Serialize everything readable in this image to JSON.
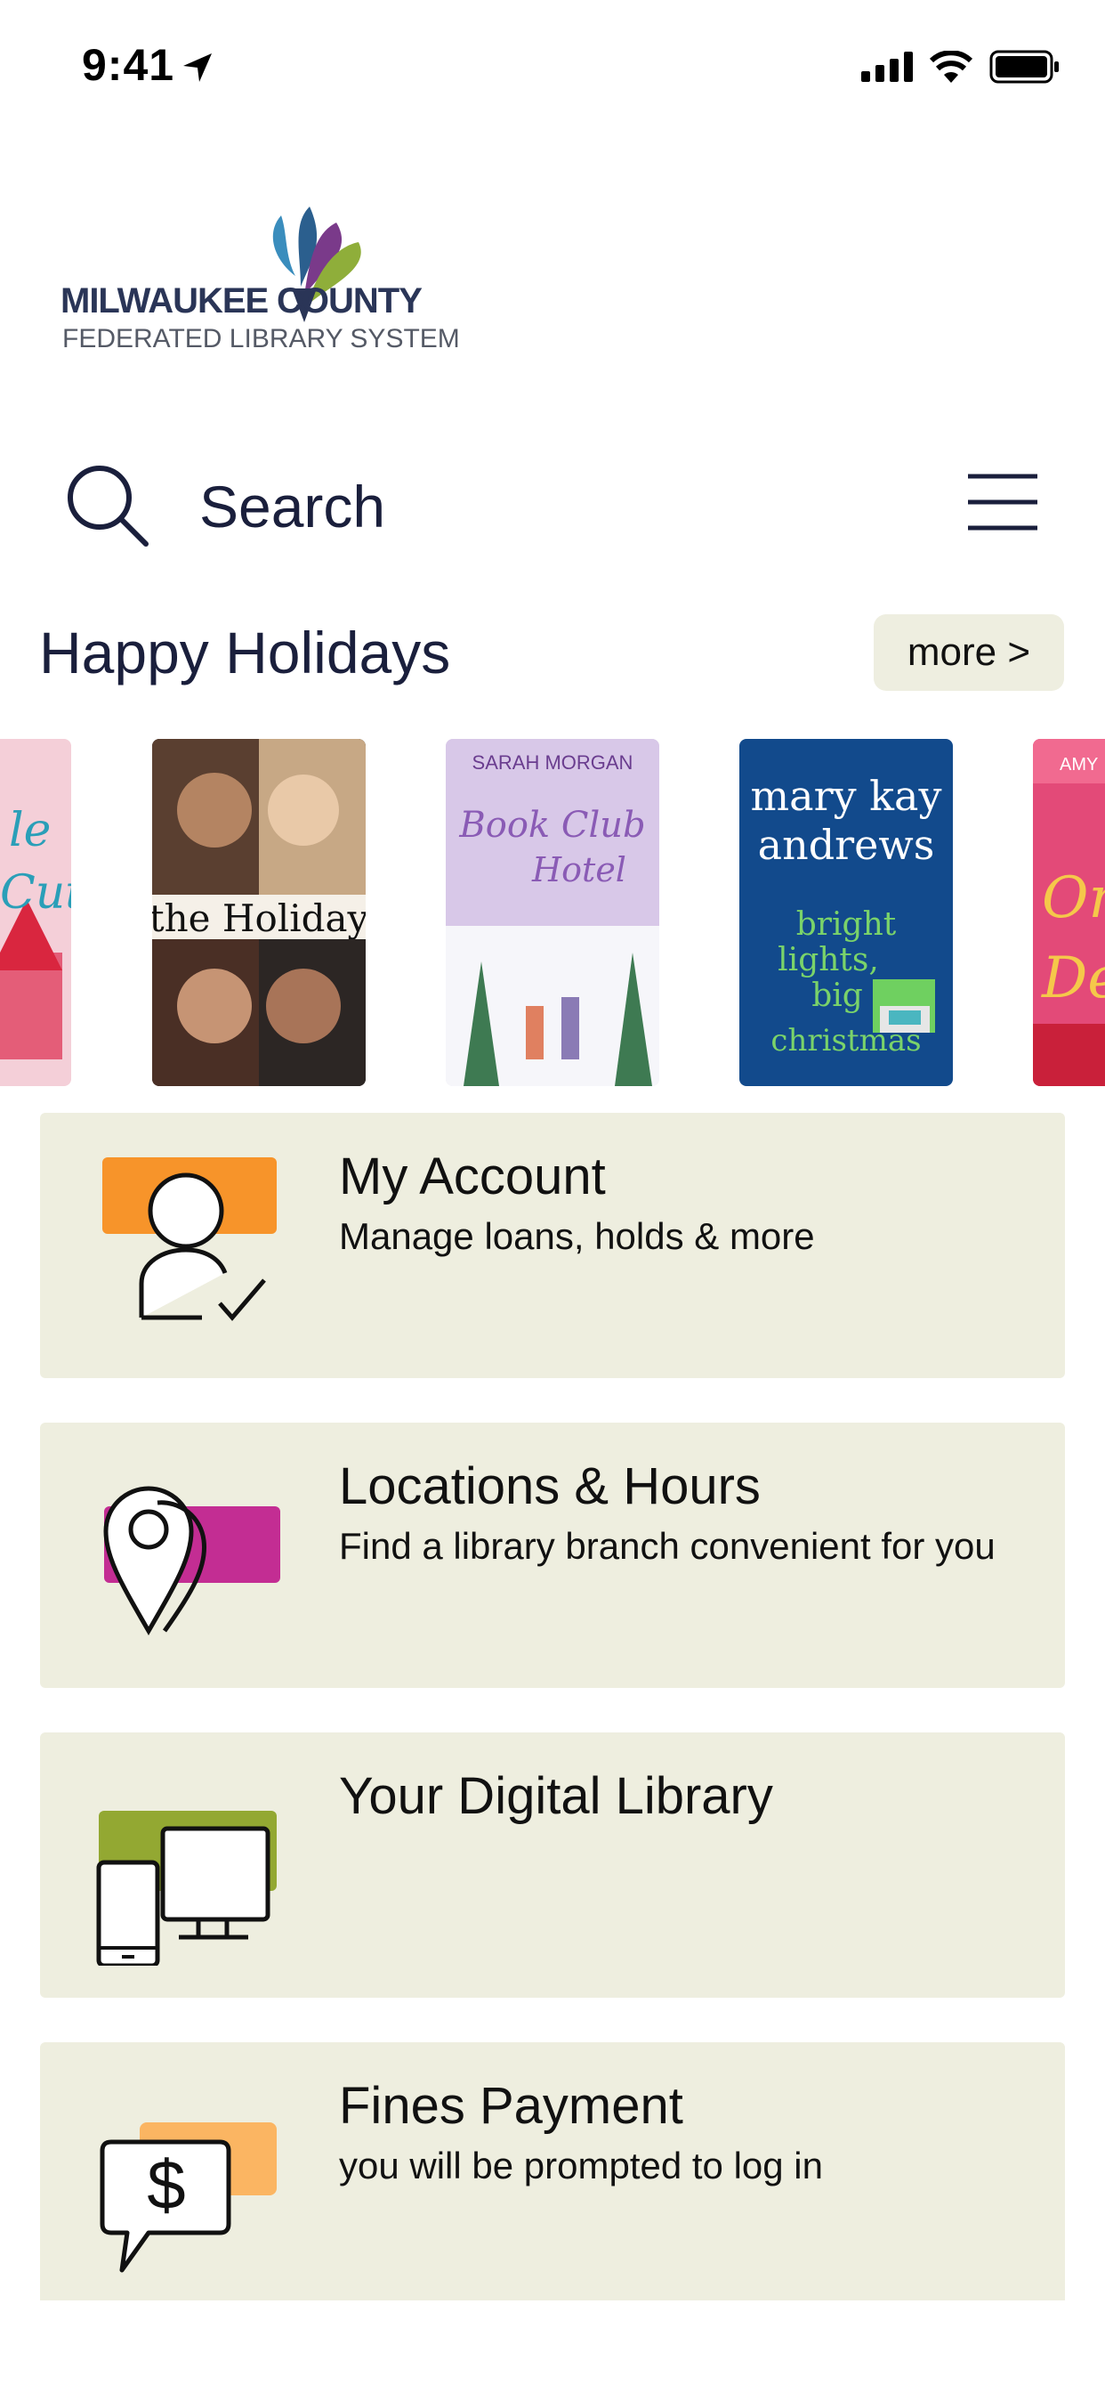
{
  "status_bar": {
    "time": "9:41"
  },
  "logo": {
    "line1_left": "MILWAUKEE",
    "line1_right": "COUNTY",
    "line2": "FEDERATED LIBRARY SYSTEM"
  },
  "search": {
    "placeholder": "Search"
  },
  "section": {
    "title": "Happy Holidays",
    "more_label": "more >"
  },
  "carousel": {
    "books": [
      {
        "title": "Jingle Cute"
      },
      {
        "title": "the Holiday"
      },
      {
        "title": "The Book Club Hotel",
        "author": "SARAH MORGAN"
      },
      {
        "title": "bright lights, big christmas",
        "author": "mary kay andrews"
      },
      {
        "title": "Once Upon a December"
      }
    ]
  },
  "cards": [
    {
      "title": "My Account",
      "subtitle": "Manage loans, holds & more",
      "accent": "#f7942a"
    },
    {
      "title": "Locations & Hours",
      "subtitle": "Find a library branch convenient for you",
      "accent": "#c32d93"
    },
    {
      "title": "Your Digital Library",
      "subtitle": "",
      "accent": "#93a832"
    },
    {
      "title": "Fines Payment",
      "subtitle": "you will be prompted to log in",
      "accent": "#fbb562"
    }
  ],
  "colors": {
    "card_bg": "#eeeedf",
    "text": "#1a1f3c",
    "more_bg": "#eeeee0"
  }
}
